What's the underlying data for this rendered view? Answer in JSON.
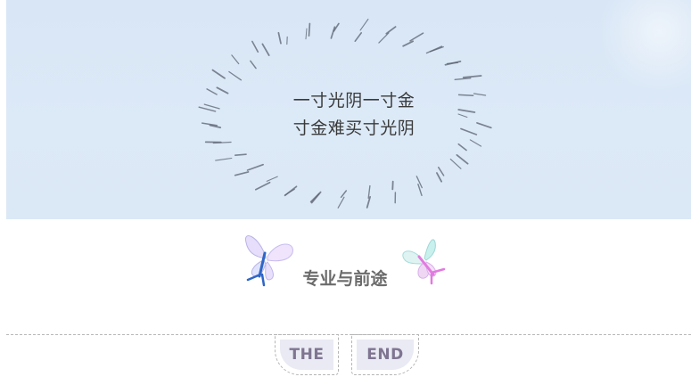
{
  "banner": {
    "quote_line_1": "一寸光阴一寸金",
    "quote_line_2": "寸金难买寸光阴"
  },
  "section": {
    "title": "专业与前途"
  },
  "footer": {
    "left_tag": "THE",
    "right_tag": "END"
  },
  "colors": {
    "banner_bg": "#dce9f7",
    "title_text": "#6b6b6b",
    "tag_bg": "#e9eaf3",
    "tag_text": "#7f7592"
  },
  "icons": [
    "butterfly-icon",
    "butterfly-icon"
  ]
}
